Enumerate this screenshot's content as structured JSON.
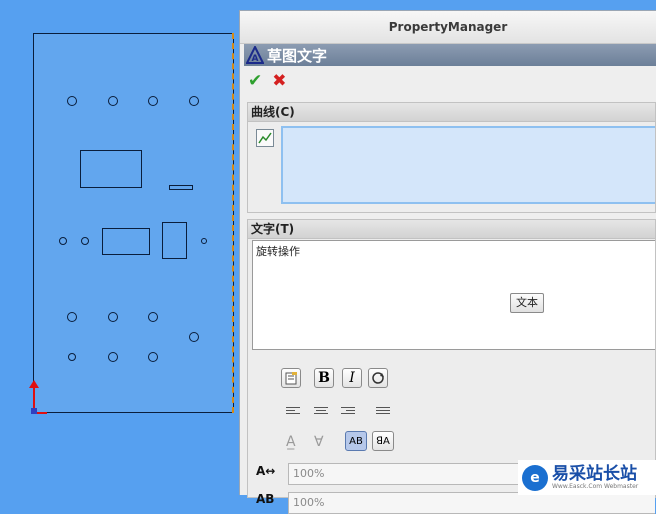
{
  "panel": {
    "title": "PropertyManager"
  },
  "feature": {
    "title": "草图文字",
    "icon": "sketch-text-icon"
  },
  "actions": {
    "ok": "✔",
    "cancel": "✖"
  },
  "curves": {
    "header": "曲线(C)",
    "icon": "curve-select-icon"
  },
  "text": {
    "header": "文字(T)",
    "value": "旋转操作",
    "font_button": "文本",
    "format_buttons": {
      "bold": "B",
      "italic": "I"
    }
  },
  "fields": {
    "width_factor": "100%",
    "spacing": "100%"
  },
  "watermark": {
    "title": "易采站长站",
    "subtitle": "Www.Easck.Com  Webmaster"
  },
  "colors": {
    "accent": "#1a6fd0",
    "ok": "#2ea02e",
    "cancel": "#d42020",
    "canvas": "#56a0f0"
  }
}
